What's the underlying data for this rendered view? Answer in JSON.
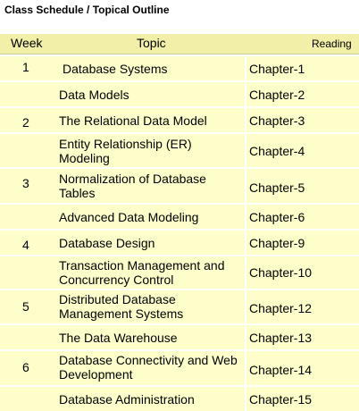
{
  "title": "Class Schedule / Topical Outline",
  "header": {
    "week": "Week",
    "topic": "Topic",
    "reading": "Reading"
  },
  "rows": [
    {
      "week": "1",
      "topic": "Database Systems",
      "reading": "Chapter-1"
    },
    {
      "week": "",
      "topic": "Data Models",
      "reading": "Chapter-2"
    },
    {
      "week": "2",
      "topic": "The Relational Data Model",
      "reading": "Chapter-3"
    },
    {
      "week": "",
      "topic": "Entity Relationship (ER) Modeling",
      "reading": "Chapter-4"
    },
    {
      "week": "3",
      "topic": "Normalization of Database Tables",
      "reading": "Chapter-5"
    },
    {
      "week": "",
      "topic": "Advanced Data Modeling",
      "reading": "Chapter-6"
    },
    {
      "week": "4",
      "topic": "Database Design",
      "reading": "Chapter-9"
    },
    {
      "week": "",
      "topic": "Transaction Management and Concurrency Control",
      "reading": "Chapter-10"
    },
    {
      "week": "5",
      "topic": "Distributed Database Management Systems",
      "reading": "Chapter-12"
    },
    {
      "week": "",
      "topic": "The Data Warehouse",
      "reading": "Chapter-13"
    },
    {
      "week": "6",
      "topic": "Database Connectivity and Web Development",
      "reading": "Chapter-14"
    },
    {
      "week": "",
      "topic": "Database Administration",
      "reading": "Chapter-15"
    }
  ]
}
